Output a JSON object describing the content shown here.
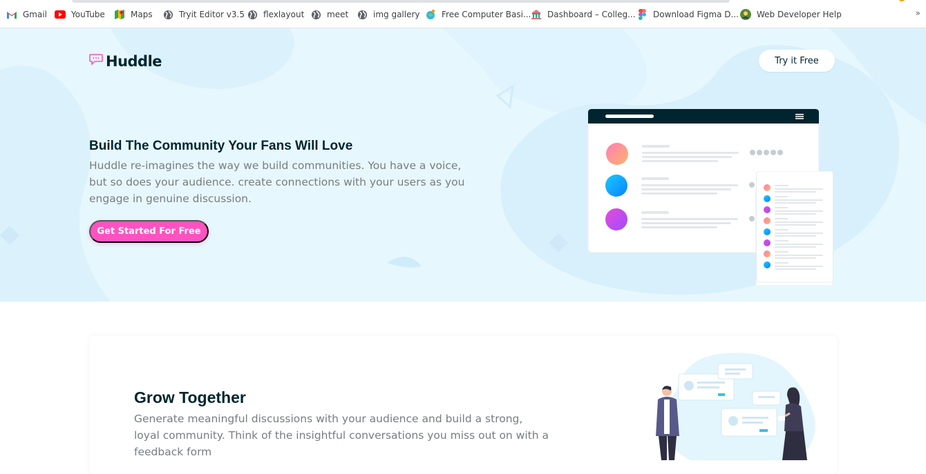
{
  "bookmarks": [
    {
      "label": "Gmail",
      "icon": "gmail-icon"
    },
    {
      "label": "YouTube",
      "icon": "youtube-icon"
    },
    {
      "label": "Maps",
      "icon": "maps-icon"
    },
    {
      "label": "Tryit Editor v3.5",
      "icon": "globe-icon"
    },
    {
      "label": "flexlayout",
      "icon": "globe-icon"
    },
    {
      "label": "meet",
      "icon": "globe-icon"
    },
    {
      "label": "img gallery",
      "icon": "globe-icon"
    },
    {
      "label": "Free Computer Basi...",
      "icon": "gcf-icon"
    },
    {
      "label": "Dashboard – Colleg...",
      "icon": "college-icon"
    },
    {
      "label": "Download Figma D...",
      "icon": "figma-icon"
    },
    {
      "label": "Web Developer Help",
      "icon": "avatar-icon"
    }
  ],
  "bookmarks_more": "»",
  "header": {
    "logo_text": "Huddle",
    "try_button": "Try it Free"
  },
  "hero": {
    "title": "Build The Community Your Fans Will Love",
    "description": "Huddle re-imagines the way we build communities. You have a voice, but so does your audience. create connections with your users as you engage in genuine discussion.",
    "cta_button": "Get Started For Free"
  },
  "feature": {
    "title": "Grow Together",
    "description": "Generate meaningful discussions with your audience and build a strong, loyal community. Think of the insightful conversations you miss out on with a feedback form"
  },
  "colors": {
    "brand_dark": "#00252e",
    "pink": "#ff52c1",
    "hero_bg": "#e7f7fe",
    "text_grey": "#777d80"
  }
}
